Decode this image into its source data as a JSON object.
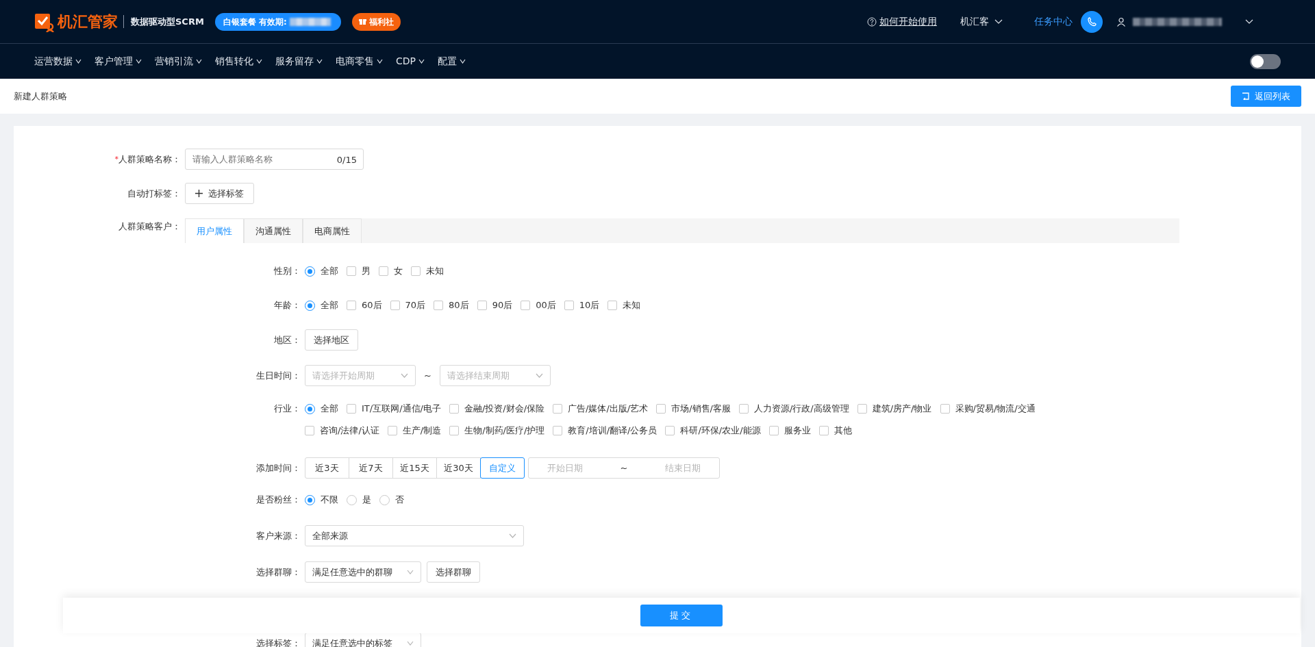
{
  "header": {
    "logo": "机汇管家",
    "tagline": "数据驱动型SCRM",
    "plan_badge": "白银套餐 有效期:",
    "welfare_badge": "福利社",
    "help_link": "如何开始使用",
    "org_menu": "机汇客",
    "task_center": "任务中心"
  },
  "nav": [
    {
      "label": "运营数据"
    },
    {
      "label": "客户管理"
    },
    {
      "label": "营销引流"
    },
    {
      "label": "销售转化"
    },
    {
      "label": "服务留存"
    },
    {
      "label": "电商零售"
    },
    {
      "label": "CDP"
    },
    {
      "label": "配置"
    }
  ],
  "nav_toggle": {
    "on": false
  },
  "page": {
    "title": "新建人群策略",
    "back_button": "返回列表"
  },
  "form": {
    "name_field": {
      "label": "人群策略名称：",
      "required_mark": "*",
      "placeholder": "请输入人群策略名称",
      "counter": "0/15"
    },
    "auto_tag": {
      "label": "自动打标签：",
      "button": "选择标签"
    },
    "audience": {
      "label": "人群策略客户：",
      "tabs": [
        {
          "label": "用户属性",
          "selected": true
        },
        {
          "label": "沟通属性",
          "selected": false
        },
        {
          "label": "电商属性",
          "selected": false
        }
      ]
    },
    "rows": [
      {
        "kind": "choices",
        "label": "性别：",
        "options": [
          {
            "kind": "radio",
            "label": "全部",
            "checked": true
          },
          {
            "kind": "checkbox",
            "label": "男",
            "checked": false
          },
          {
            "kind": "checkbox",
            "label": "女",
            "checked": false
          },
          {
            "kind": "checkbox",
            "label": "未知",
            "checked": false
          }
        ]
      },
      {
        "kind": "choices",
        "label": "年龄：",
        "options": [
          {
            "kind": "radio",
            "label": "全部",
            "checked": true
          },
          {
            "kind": "checkbox",
            "label": "60后",
            "checked": false
          },
          {
            "kind": "checkbox",
            "label": "70后",
            "checked": false
          },
          {
            "kind": "checkbox",
            "label": "80后",
            "checked": false
          },
          {
            "kind": "checkbox",
            "label": "90后",
            "checked": false
          },
          {
            "kind": "checkbox",
            "label": "00后",
            "checked": false
          },
          {
            "kind": "checkbox",
            "label": "10后",
            "checked": false
          },
          {
            "kind": "checkbox",
            "label": "未知",
            "checked": false
          }
        ]
      },
      {
        "kind": "button",
        "label": "地区：",
        "button": "选择地区"
      },
      {
        "kind": "range",
        "label": "生日时间：",
        "start_placeholder": "请选择开始周期",
        "separator": "~",
        "end_placeholder": "请选择结束周期"
      },
      {
        "kind": "choices",
        "label": "行业：",
        "options": [
          {
            "kind": "radio",
            "label": "全部",
            "checked": true
          },
          {
            "kind": "checkbox",
            "label": "IT/互联网/通信/电子",
            "checked": false
          },
          {
            "kind": "checkbox",
            "label": "金融/投资/财会/保险",
            "checked": false
          },
          {
            "kind": "checkbox",
            "label": "广告/媒体/出版/艺术",
            "checked": false
          },
          {
            "kind": "checkbox",
            "label": "市场/销售/客服",
            "checked": false
          },
          {
            "kind": "checkbox",
            "label": "人力资源/行政/高级管理",
            "checked": false
          },
          {
            "kind": "checkbox",
            "label": "建筑/房产/物业",
            "checked": false
          },
          {
            "kind": "checkbox",
            "label": "采购/贸易/物流/交通",
            "checked": false
          },
          {
            "kind": "checkbox",
            "label": "咨询/法律/认证",
            "checked": false
          },
          {
            "kind": "checkbox",
            "label": "生产/制造",
            "checked": false
          },
          {
            "kind": "checkbox",
            "label": "生物/制药/医疗/护理",
            "checked": false
          },
          {
            "kind": "checkbox",
            "label": "教育/培训/翻译/公务员",
            "checked": false
          },
          {
            "kind": "checkbox",
            "label": "科研/环保/农业/能源",
            "checked": false
          },
          {
            "kind": "checkbox",
            "label": "服务业",
            "checked": false
          },
          {
            "kind": "checkbox",
            "label": "其他",
            "checked": false
          }
        ]
      },
      {
        "kind": "segmented",
        "label": "添加时间：",
        "segments": [
          {
            "label": "近3天",
            "selected": false
          },
          {
            "label": "近7天",
            "selected": false
          },
          {
            "label": "近15天",
            "selected": false
          },
          {
            "label": "近30天",
            "selected": false
          },
          {
            "label": "自定义",
            "selected": true
          }
        ],
        "date_range": {
          "start_placeholder": "开始日期",
          "separator": "~",
          "end_placeholder": "结束日期"
        }
      },
      {
        "kind": "choices",
        "label": "是否粉丝：",
        "options": [
          {
            "kind": "radio",
            "label": "不限",
            "checked": true
          },
          {
            "kind": "radio",
            "label": "是",
            "checked": false
          },
          {
            "kind": "radio",
            "label": "否",
            "checked": false
          }
        ]
      },
      {
        "kind": "select",
        "label": "客户来源：",
        "value": "全部来源"
      },
      {
        "kind": "picker",
        "label": "选择群聊：",
        "value": "满足任意选中的群聊",
        "button": "选择群聊"
      },
      {
        "kind": "picker",
        "label": "选择标签：",
        "value": "满足任意选中的标签"
      }
    ]
  },
  "footer": {
    "submit": "提交"
  }
}
